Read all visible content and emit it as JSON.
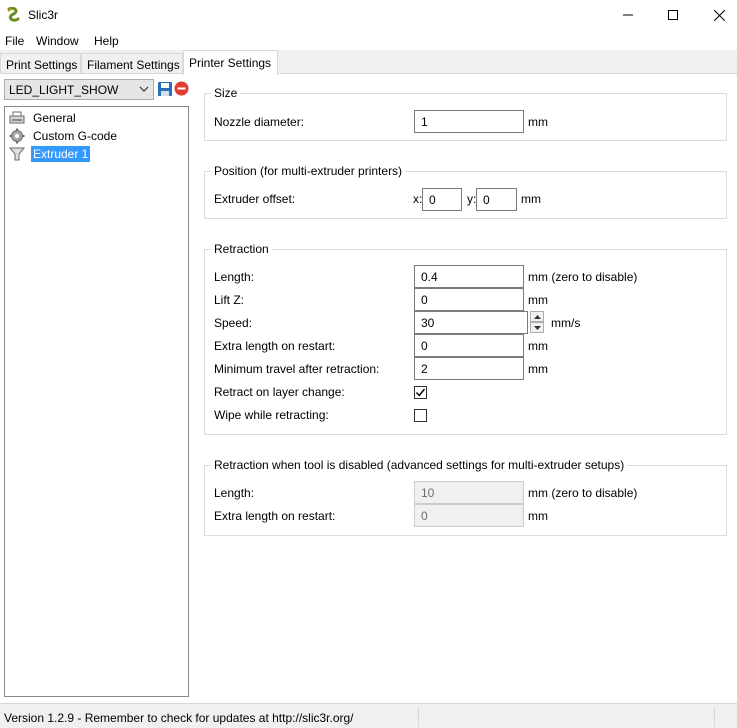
{
  "window": {
    "title": "Slic3r"
  },
  "menu": {
    "file": "File",
    "window": "Window",
    "help": "Help"
  },
  "tabs": [
    {
      "label": "Print Settings"
    },
    {
      "label": "Filament Settings"
    },
    {
      "label": "Printer Settings"
    }
  ],
  "preset": {
    "selected": "LED_LIGHT_SHOW"
  },
  "tree": [
    {
      "label": "General",
      "icon": "printer-icon"
    },
    {
      "label": "Custom G-code",
      "icon": "cog-icon"
    },
    {
      "label": "Extruder 1",
      "icon": "funnel-icon"
    }
  ],
  "size": {
    "title": "Size",
    "nozzle_label": "Nozzle diameter:",
    "nozzle_value": "1",
    "nozzle_unit": "mm"
  },
  "position": {
    "title": "Position (for multi-extruder printers)",
    "offset_label": "Extruder offset:",
    "x_label": "x:",
    "x_value": "0",
    "y_label": "y:",
    "y_value": "0",
    "unit": "mm"
  },
  "retraction": {
    "title": "Retraction",
    "length_label": "Length:",
    "length_value": "0.4",
    "length_unit": "mm (zero to disable)",
    "liftz_label": "Lift Z:",
    "liftz_value": "0",
    "liftz_unit": "mm",
    "speed_label": "Speed:",
    "speed_value": "30",
    "speed_unit": "mm/s",
    "extra_label": "Extra length on restart:",
    "extra_value": "0",
    "extra_unit": "mm",
    "mintravel_label": "Minimum travel after retraction:",
    "mintravel_value": "2",
    "mintravel_unit": "mm",
    "layerchange_label": "Retract on layer change:",
    "layerchange_checked": true,
    "wipe_label": "Wipe while retracting:",
    "wipe_checked": false
  },
  "retraction_disabled": {
    "title": "Retraction when tool is disabled (advanced settings for multi-extruder setups)",
    "length_label": "Length:",
    "length_value": "10",
    "length_unit": "mm (zero to disable)",
    "extra_label": "Extra length on restart:",
    "extra_value": "0",
    "extra_unit": "mm"
  },
  "status": {
    "text": "Version 1.2.9 - Remember to check for updates at http://slic3r.org/"
  },
  "colors": {
    "selection": "#3399ff",
    "accent_close": "#e81123"
  }
}
